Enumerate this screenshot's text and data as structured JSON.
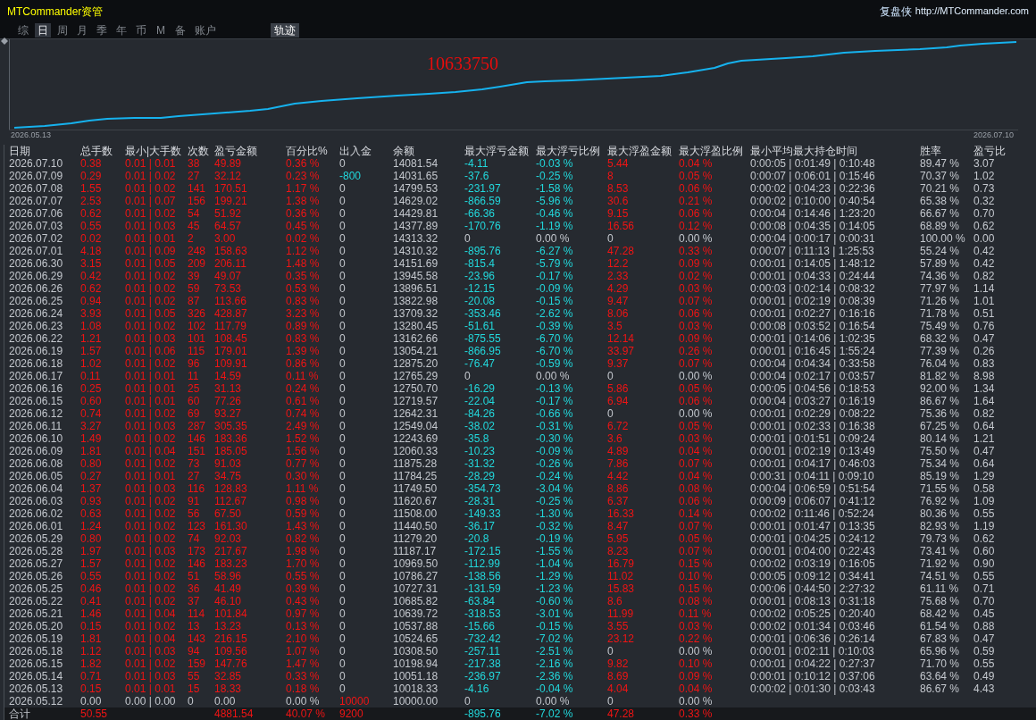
{
  "title_bar": {
    "title": "MTCommander资管",
    "brand": "复盘侠",
    "link": "http://MTCommander.com"
  },
  "tabs": [
    {
      "label": "综",
      "selected": false
    },
    {
      "label": "日",
      "selected": true
    },
    {
      "label": "周",
      "selected": false
    },
    {
      "label": "月",
      "selected": false
    },
    {
      "label": "季",
      "selected": false
    },
    {
      "label": "年",
      "selected": false
    },
    {
      "label": "币",
      "selected": false
    },
    {
      "label": "M",
      "selected": false
    },
    {
      "label": "备",
      "selected": false
    },
    {
      "label": "账户",
      "selected": false
    }
  ],
  "track_toggle": {
    "label": "轨迹",
    "on": true
  },
  "chart": {
    "value": "10633750",
    "x_start": "2026.05.13",
    "x_end": "2026.07.10"
  },
  "table": {
    "columns": [
      "日期",
      "总手数",
      "最小|大手数",
      "次数",
      "盈亏金额",
      "百分比%",
      "出入金",
      "余额",
      "最大浮亏金额",
      "最大浮亏比例",
      "最大浮盈金额",
      "最大浮盈比例",
      "最小平均最大持仓时间",
      "胜率",
      "盈亏比"
    ],
    "rows": [
      [
        "2026.07.10",
        {
          "text": "0.38",
          "color": "#f01414"
        },
        {
          "text": "0.01 | 0.01",
          "color": "#f01414"
        },
        {
          "text": "38",
          "color": "#f01414"
        },
        {
          "text": "49.89",
          "color": "#f01414"
        },
        {
          "text": "0.36 %",
          "color": "#f01414"
        },
        "0",
        "14081.54",
        {
          "text": "-4.11",
          "color": "#22d8dc"
        },
        {
          "text": "-0.03 %",
          "color": "#22d8dc"
        },
        {
          "text": "5.44",
          "color": "#f01414"
        },
        {
          "text": "0.04 %",
          "color": "#f01414"
        },
        "0:00:05 | 0:01:49 | 0:10:48",
        "89.47 %",
        "3.07"
      ],
      [
        "2026.07.09",
        {
          "text": "0.29",
          "color": "#f01414"
        },
        {
          "text": "0.01 | 0.02",
          "color": "#f01414"
        },
        {
          "text": "27",
          "color": "#f01414"
        },
        {
          "text": "32.12",
          "color": "#f01414"
        },
        {
          "text": "0.23 %",
          "color": "#f01414"
        },
        {
          "text": "-800",
          "color": "#22d8dc"
        },
        "14031.65",
        {
          "text": "-37.6",
          "color": "#22d8dc"
        },
        {
          "text": "-0.25 %",
          "color": "#22d8dc"
        },
        {
          "text": "8",
          "color": "#f01414"
        },
        {
          "text": "0.05 %",
          "color": "#f01414"
        },
        "0:00:07 | 0:06:01 | 0:15:46",
        "70.37 %",
        "1.02"
      ],
      [
        "2026.07.08",
        {
          "text": "1.55",
          "color": "#f01414"
        },
        {
          "text": "0.01 | 0.02",
          "color": "#f01414"
        },
        {
          "text": "141",
          "color": "#f01414"
        },
        {
          "text": "170.51",
          "color": "#f01414"
        },
        {
          "text": "1.17 %",
          "color": "#f01414"
        },
        "0",
        "14799.53",
        {
          "text": "-231.97",
          "color": "#22d8dc"
        },
        {
          "text": "-1.58 %",
          "color": "#22d8dc"
        },
        {
          "text": "8.53",
          "color": "#f01414"
        },
        {
          "text": "0.06 %",
          "color": "#f01414"
        },
        "0:00:02 | 0:04:23 | 0:22:36",
        "70.21 %",
        "0.73"
      ],
      [
        "2026.07.07",
        {
          "text": "2.53",
          "color": "#f01414"
        },
        {
          "text": "0.01 | 0.07",
          "color": "#f01414"
        },
        {
          "text": "156",
          "color": "#f01414"
        },
        {
          "text": "199.21",
          "color": "#f01414"
        },
        {
          "text": "1.38 %",
          "color": "#f01414"
        },
        "0",
        "14629.02",
        {
          "text": "-866.59",
          "color": "#22d8dc"
        },
        {
          "text": "-5.96 %",
          "color": "#22d8dc"
        },
        {
          "text": "30.6",
          "color": "#f01414"
        },
        {
          "text": "0.21 %",
          "color": "#f01414"
        },
        "0:00:02 | 0:10:00 | 0:40:54",
        "65.38 %",
        "0.32"
      ],
      [
        "2026.07.06",
        {
          "text": "0.62",
          "color": "#f01414"
        },
        {
          "text": "0.01 | 0.02",
          "color": "#f01414"
        },
        {
          "text": "54",
          "color": "#f01414"
        },
        {
          "text": "51.92",
          "color": "#f01414"
        },
        {
          "text": "0.36 %",
          "color": "#f01414"
        },
        "0",
        "14429.81",
        {
          "text": "-66.36",
          "color": "#22d8dc"
        },
        {
          "text": "-0.46 %",
          "color": "#22d8dc"
        },
        {
          "text": "9.15",
          "color": "#f01414"
        },
        {
          "text": "0.06 %",
          "color": "#f01414"
        },
        "0:00:04 | 0:14:46 | 1:23:20",
        "66.67 %",
        "0.70"
      ],
      [
        "2026.07.03",
        {
          "text": "0.55",
          "color": "#f01414"
        },
        {
          "text": "0.01 | 0.03",
          "color": "#f01414"
        },
        {
          "text": "45",
          "color": "#f01414"
        },
        {
          "text": "64.57",
          "color": "#f01414"
        },
        {
          "text": "0.45 %",
          "color": "#f01414"
        },
        "0",
        "14377.89",
        {
          "text": "-170.76",
          "color": "#22d8dc"
        },
        {
          "text": "-1.19 %",
          "color": "#22d8dc"
        },
        {
          "text": "16.56",
          "color": "#f01414"
        },
        {
          "text": "0.12 %",
          "color": "#f01414"
        },
        "0:00:08 | 0:04:35 | 0:14:05",
        "68.89 %",
        "0.62"
      ],
      [
        "2026.07.02",
        {
          "text": "0.02",
          "color": "#f01414"
        },
        {
          "text": "0.01 | 0.01",
          "color": "#f01414"
        },
        {
          "text": "2",
          "color": "#f01414"
        },
        {
          "text": "3.00",
          "color": "#f01414"
        },
        {
          "text": "0.02 %",
          "color": "#f01414"
        },
        "0",
        "14313.32",
        "0",
        "0.00 %",
        "0",
        "0.00 %",
        "0:00:04 | 0:00:17 | 0:00:31",
        "100.00 %",
        "0.00"
      ],
      [
        "2026.07.01",
        {
          "text": "4.18",
          "color": "#f01414"
        },
        {
          "text": "0.01 | 0.09",
          "color": "#f01414"
        },
        {
          "text": "248",
          "color": "#f01414"
        },
        {
          "text": "158.63",
          "color": "#f01414"
        },
        {
          "text": "1.12 %",
          "color": "#f01414"
        },
        "0",
        "14310.32",
        {
          "text": "-895.76",
          "color": "#22d8dc"
        },
        {
          "text": "-6.27 %",
          "color": "#22d8dc"
        },
        {
          "text": "47.28",
          "color": "#f01414"
        },
        {
          "text": "0.33 %",
          "color": "#f01414"
        },
        "0:00:07 | 0:11:13 | 1:25:53",
        "55.24 %",
        "0.42"
      ],
      [
        "2026.06.30",
        {
          "text": "3.15",
          "color": "#f01414"
        },
        {
          "text": "0.01 | 0.05",
          "color": "#f01414"
        },
        {
          "text": "209",
          "color": "#f01414"
        },
        {
          "text": "206.11",
          "color": "#f01414"
        },
        {
          "text": "1.48 %",
          "color": "#f01414"
        },
        "0",
        "14151.69",
        {
          "text": "-815.4",
          "color": "#22d8dc"
        },
        {
          "text": "-5.79 %",
          "color": "#22d8dc"
        },
        {
          "text": "12.2",
          "color": "#f01414"
        },
        {
          "text": "0.09 %",
          "color": "#f01414"
        },
        "0:00:01 | 0:14:05 | 1:48:12",
        "57.89 %",
        "0.42"
      ],
      [
        "2026.06.29",
        {
          "text": "0.42",
          "color": "#f01414"
        },
        {
          "text": "0.01 | 0.02",
          "color": "#f01414"
        },
        {
          "text": "39",
          "color": "#f01414"
        },
        {
          "text": "49.07",
          "color": "#f01414"
        },
        {
          "text": "0.35 %",
          "color": "#f01414"
        },
        "0",
        "13945.58",
        {
          "text": "-23.96",
          "color": "#22d8dc"
        },
        {
          "text": "-0.17 %",
          "color": "#22d8dc"
        },
        {
          "text": "2.33",
          "color": "#f01414"
        },
        {
          "text": "0.02 %",
          "color": "#f01414"
        },
        "0:00:01 | 0:04:33 | 0:24:44",
        "74.36 %",
        "0.82"
      ],
      [
        "2026.06.26",
        {
          "text": "0.62",
          "color": "#f01414"
        },
        {
          "text": "0.01 | 0.02",
          "color": "#f01414"
        },
        {
          "text": "59",
          "color": "#f01414"
        },
        {
          "text": "73.53",
          "color": "#f01414"
        },
        {
          "text": "0.53 %",
          "color": "#f01414"
        },
        "0",
        "13896.51",
        {
          "text": "-12.15",
          "color": "#22d8dc"
        },
        {
          "text": "-0.09 %",
          "color": "#22d8dc"
        },
        {
          "text": "4.29",
          "color": "#f01414"
        },
        {
          "text": "0.03 %",
          "color": "#f01414"
        },
        "0:00:03 | 0:02:14 | 0:08:32",
        "77.97 %",
        "1.14"
      ],
      [
        "2026.06.25",
        {
          "text": "0.94",
          "color": "#f01414"
        },
        {
          "text": "0.01 | 0.02",
          "color": "#f01414"
        },
        {
          "text": "87",
          "color": "#f01414"
        },
        {
          "text": "113.66",
          "color": "#f01414"
        },
        {
          "text": "0.83 %",
          "color": "#f01414"
        },
        "0",
        "13822.98",
        {
          "text": "-20.08",
          "color": "#22d8dc"
        },
        {
          "text": "-0.15 %",
          "color": "#22d8dc"
        },
        {
          "text": "9.47",
          "color": "#f01414"
        },
        {
          "text": "0.07 %",
          "color": "#f01414"
        },
        "0:00:01 | 0:02:19 | 0:08:39",
        "71.26 %",
        "1.01"
      ],
      [
        "2026.06.24",
        {
          "text": "3.93",
          "color": "#f01414"
        },
        {
          "text": "0.01 | 0.05",
          "color": "#f01414"
        },
        {
          "text": "326",
          "color": "#f01414"
        },
        {
          "text": "428.87",
          "color": "#f01414"
        },
        {
          "text": "3.23 %",
          "color": "#f01414"
        },
        "0",
        "13709.32",
        {
          "text": "-353.46",
          "color": "#22d8dc"
        },
        {
          "text": "-2.62 %",
          "color": "#22d8dc"
        },
        {
          "text": "8.06",
          "color": "#f01414"
        },
        {
          "text": "0.06 %",
          "color": "#f01414"
        },
        "0:00:01 | 0:02:27 | 0:16:16",
        "71.78 %",
        "0.51"
      ],
      [
        "2026.06.23",
        {
          "text": "1.08",
          "color": "#f01414"
        },
        {
          "text": "0.01 | 0.02",
          "color": "#f01414"
        },
        {
          "text": "102",
          "color": "#f01414"
        },
        {
          "text": "117.79",
          "color": "#f01414"
        },
        {
          "text": "0.89 %",
          "color": "#f01414"
        },
        "0",
        "13280.45",
        {
          "text": "-51.61",
          "color": "#22d8dc"
        },
        {
          "text": "-0.39 %",
          "color": "#22d8dc"
        },
        {
          "text": "3.5",
          "color": "#f01414"
        },
        {
          "text": "0.03 %",
          "color": "#f01414"
        },
        "0:00:08 | 0:03:52 | 0:16:54",
        "75.49 %",
        "0.76"
      ],
      [
        "2026.06.22",
        {
          "text": "1.21",
          "color": "#f01414"
        },
        {
          "text": "0.01 | 0.03",
          "color": "#f01414"
        },
        {
          "text": "101",
          "color": "#f01414"
        },
        {
          "text": "108.45",
          "color": "#f01414"
        },
        {
          "text": "0.83 %",
          "color": "#f01414"
        },
        "0",
        "13162.66",
        {
          "text": "-875.55",
          "color": "#22d8dc"
        },
        {
          "text": "-6.70 %",
          "color": "#22d8dc"
        },
        {
          "text": "12.14",
          "color": "#f01414"
        },
        {
          "text": "0.09 %",
          "color": "#f01414"
        },
        "0:00:01 | 0:14:06 | 1:02:35",
        "68.32 %",
        "0.47"
      ],
      [
        "2026.06.19",
        {
          "text": "1.57",
          "color": "#f01414"
        },
        {
          "text": "0.01 | 0.06",
          "color": "#f01414"
        },
        {
          "text": "115",
          "color": "#f01414"
        },
        {
          "text": "179.01",
          "color": "#f01414"
        },
        {
          "text": "1.39 %",
          "color": "#f01414"
        },
        "0",
        "13054.21",
        {
          "text": "-866.95",
          "color": "#22d8dc"
        },
        {
          "text": "-6.70 %",
          "color": "#22d8dc"
        },
        {
          "text": "33.97",
          "color": "#f01414"
        },
        {
          "text": "0.26 %",
          "color": "#f01414"
        },
        "0:00:01 | 0:16:45 | 1:55:24",
        "77.39 %",
        "0.26"
      ],
      [
        "2026.06.18",
        {
          "text": "1.02",
          "color": "#f01414"
        },
        {
          "text": "0.01 | 0.02",
          "color": "#f01414"
        },
        {
          "text": "96",
          "color": "#f01414"
        },
        {
          "text": "109.91",
          "color": "#f01414"
        },
        {
          "text": "0.86 %",
          "color": "#f01414"
        },
        "0",
        "12875.20",
        {
          "text": "-76.47",
          "color": "#22d8dc"
        },
        {
          "text": "-0.59 %",
          "color": "#22d8dc"
        },
        {
          "text": "9.37",
          "color": "#f01414"
        },
        {
          "text": "0.07 %",
          "color": "#f01414"
        },
        "0:00:04 | 0:04:34 | 0:33:58",
        "76.04 %",
        "0.83"
      ],
      [
        "2026.06.17",
        {
          "text": "0.11",
          "color": "#f01414"
        },
        {
          "text": "0.01 | 0.01",
          "color": "#f01414"
        },
        {
          "text": "11",
          "color": "#f01414"
        },
        {
          "text": "14.59",
          "color": "#f01414"
        },
        {
          "text": "0.11 %",
          "color": "#f01414"
        },
        "0",
        "12765.29",
        "0",
        "0.00 %",
        "0",
        "0.00 %",
        "0:00:04 | 0:02:17 | 0:03:57",
        "81.82 %",
        "8.98"
      ],
      [
        "2026.06.16",
        {
          "text": "0.25",
          "color": "#f01414"
        },
        {
          "text": "0.01 | 0.01",
          "color": "#f01414"
        },
        {
          "text": "25",
          "color": "#f01414"
        },
        {
          "text": "31.13",
          "color": "#f01414"
        },
        {
          "text": "0.24 %",
          "color": "#f01414"
        },
        "0",
        "12750.70",
        {
          "text": "-16.29",
          "color": "#22d8dc"
        },
        {
          "text": "-0.13 %",
          "color": "#22d8dc"
        },
        {
          "text": "5.86",
          "color": "#f01414"
        },
        {
          "text": "0.05 %",
          "color": "#f01414"
        },
        "0:00:05 | 0:04:56 | 0:18:53",
        "92.00 %",
        "1.34"
      ],
      [
        "2026.06.15",
        {
          "text": "0.60",
          "color": "#f01414"
        },
        {
          "text": "0.01 | 0.01",
          "color": "#f01414"
        },
        {
          "text": "60",
          "color": "#f01414"
        },
        {
          "text": "77.26",
          "color": "#f01414"
        },
        {
          "text": "0.61 %",
          "color": "#f01414"
        },
        "0",
        "12719.57",
        {
          "text": "-22.04",
          "color": "#22d8dc"
        },
        {
          "text": "-0.17 %",
          "color": "#22d8dc"
        },
        {
          "text": "6.94",
          "color": "#f01414"
        },
        {
          "text": "0.06 %",
          "color": "#f01414"
        },
        "0:00:04 | 0:03:27 | 0:16:19",
        "86.67 %",
        "1.64"
      ],
      [
        "2026.06.12",
        {
          "text": "0.74",
          "color": "#f01414"
        },
        {
          "text": "0.01 | 0.02",
          "color": "#f01414"
        },
        {
          "text": "69",
          "color": "#f01414"
        },
        {
          "text": "93.27",
          "color": "#f01414"
        },
        {
          "text": "0.74 %",
          "color": "#f01414"
        },
        "0",
        "12642.31",
        {
          "text": "-84.26",
          "color": "#22d8dc"
        },
        {
          "text": "-0.66 %",
          "color": "#22d8dc"
        },
        "0",
        "0.00 %",
        "0:00:01 | 0:02:29 | 0:08:22",
        "75.36 %",
        "0.82"
      ],
      [
        "2026.06.11",
        {
          "text": "3.27",
          "color": "#f01414"
        },
        {
          "text": "0.01 | 0.03",
          "color": "#f01414"
        },
        {
          "text": "287",
          "color": "#f01414"
        },
        {
          "text": "305.35",
          "color": "#f01414"
        },
        {
          "text": "2.49 %",
          "color": "#f01414"
        },
        "0",
        "12549.04",
        {
          "text": "-38.02",
          "color": "#22d8dc"
        },
        {
          "text": "-0.31 %",
          "color": "#22d8dc"
        },
        {
          "text": "6.72",
          "color": "#f01414"
        },
        {
          "text": "0.05 %",
          "color": "#f01414"
        },
        "0:00:01 | 0:02:33 | 0:16:38",
        "67.25 %",
        "0.64"
      ],
      [
        "2026.06.10",
        {
          "text": "1.49",
          "color": "#f01414"
        },
        {
          "text": "0.01 | 0.02",
          "color": "#f01414"
        },
        {
          "text": "146",
          "color": "#f01414"
        },
        {
          "text": "183.36",
          "color": "#f01414"
        },
        {
          "text": "1.52 %",
          "color": "#f01414"
        },
        "0",
        "12243.69",
        {
          "text": "-35.8",
          "color": "#22d8dc"
        },
        {
          "text": "-0.30 %",
          "color": "#22d8dc"
        },
        {
          "text": "3.6",
          "color": "#f01414"
        },
        {
          "text": "0.03 %",
          "color": "#f01414"
        },
        "0:00:01 | 0:01:51 | 0:09:24",
        "80.14 %",
        "1.21"
      ],
      [
        "2026.06.09",
        {
          "text": "1.81",
          "color": "#f01414"
        },
        {
          "text": "0.01 | 0.04",
          "color": "#f01414"
        },
        {
          "text": "151",
          "color": "#f01414"
        },
        {
          "text": "185.05",
          "color": "#f01414"
        },
        {
          "text": "1.56 %",
          "color": "#f01414"
        },
        "0",
        "12060.33",
        {
          "text": "-10.23",
          "color": "#22d8dc"
        },
        {
          "text": "-0.09 %",
          "color": "#22d8dc"
        },
        {
          "text": "4.89",
          "color": "#f01414"
        },
        {
          "text": "0.04 %",
          "color": "#f01414"
        },
        "0:00:01 | 0:02:19 | 0:13:49",
        "75.50 %",
        "0.47"
      ],
      [
        "2026.06.08",
        {
          "text": "0.80",
          "color": "#f01414"
        },
        {
          "text": "0.01 | 0.02",
          "color": "#f01414"
        },
        {
          "text": "73",
          "color": "#f01414"
        },
        {
          "text": "91.03",
          "color": "#f01414"
        },
        {
          "text": "0.77 %",
          "color": "#f01414"
        },
        "0",
        "11875.28",
        {
          "text": "-31.32",
          "color": "#22d8dc"
        },
        {
          "text": "-0.26 %",
          "color": "#22d8dc"
        },
        {
          "text": "7.86",
          "color": "#f01414"
        },
        {
          "text": "0.07 %",
          "color": "#f01414"
        },
        "0:00:01 | 0:04:17 | 0:46:03",
        "75.34 %",
        "0.64"
      ],
      [
        "2026.06.05",
        {
          "text": "0.27",
          "color": "#f01414"
        },
        {
          "text": "0.01 | 0.01",
          "color": "#f01414"
        },
        {
          "text": "27",
          "color": "#f01414"
        },
        {
          "text": "34.75",
          "color": "#f01414"
        },
        {
          "text": "0.30 %",
          "color": "#f01414"
        },
        "0",
        "11784.25",
        {
          "text": "-28.29",
          "color": "#22d8dc"
        },
        {
          "text": "-0.24 %",
          "color": "#22d8dc"
        },
        {
          "text": "4.42",
          "color": "#f01414"
        },
        {
          "text": "0.04 %",
          "color": "#f01414"
        },
        "0:00:31 | 0:04:11 | 0:09:10",
        "85.19 %",
        "1.29"
      ],
      [
        "2026.06.04",
        {
          "text": "1.37",
          "color": "#f01414"
        },
        {
          "text": "0.01 | 0.03",
          "color": "#f01414"
        },
        {
          "text": "116",
          "color": "#f01414"
        },
        {
          "text": "128.83",
          "color": "#f01414"
        },
        {
          "text": "1.11 %",
          "color": "#f01414"
        },
        "0",
        "11749.50",
        {
          "text": "-354.73",
          "color": "#22d8dc"
        },
        {
          "text": "-3.04 %",
          "color": "#22d8dc"
        },
        {
          "text": "8.86",
          "color": "#f01414"
        },
        {
          "text": "0.08 %",
          "color": "#f01414"
        },
        "0:00:04 | 0:06:59 | 0:51:54",
        "71.55 %",
        "0.58"
      ],
      [
        "2026.06.03",
        {
          "text": "0.93",
          "color": "#f01414"
        },
        {
          "text": "0.01 | 0.02",
          "color": "#f01414"
        },
        {
          "text": "91",
          "color": "#f01414"
        },
        {
          "text": "112.67",
          "color": "#f01414"
        },
        {
          "text": "0.98 %",
          "color": "#f01414"
        },
        "0",
        "11620.67",
        {
          "text": "-28.31",
          "color": "#22d8dc"
        },
        {
          "text": "-0.25 %",
          "color": "#22d8dc"
        },
        {
          "text": "6.37",
          "color": "#f01414"
        },
        {
          "text": "0.06 %",
          "color": "#f01414"
        },
        "0:00:09 | 0:06:07 | 0:41:12",
        "76.92 %",
        "1.09"
      ],
      [
        "2026.06.02",
        {
          "text": "0.63",
          "color": "#f01414"
        },
        {
          "text": "0.01 | 0.02",
          "color": "#f01414"
        },
        {
          "text": "56",
          "color": "#f01414"
        },
        {
          "text": "67.50",
          "color": "#f01414"
        },
        {
          "text": "0.59 %",
          "color": "#f01414"
        },
        "0",
        "11508.00",
        {
          "text": "-149.33",
          "color": "#22d8dc"
        },
        {
          "text": "-1.30 %",
          "color": "#22d8dc"
        },
        {
          "text": "16.33",
          "color": "#f01414"
        },
        {
          "text": "0.14 %",
          "color": "#f01414"
        },
        "0:00:02 | 0:11:46 | 0:52:24",
        "80.36 %",
        "0.55"
      ],
      [
        "2026.06.01",
        {
          "text": "1.24",
          "color": "#f01414"
        },
        {
          "text": "0.01 | 0.02",
          "color": "#f01414"
        },
        {
          "text": "123",
          "color": "#f01414"
        },
        {
          "text": "161.30",
          "color": "#f01414"
        },
        {
          "text": "1.43 %",
          "color": "#f01414"
        },
        "0",
        "11440.50",
        {
          "text": "-36.17",
          "color": "#22d8dc"
        },
        {
          "text": "-0.32 %",
          "color": "#22d8dc"
        },
        {
          "text": "8.47",
          "color": "#f01414"
        },
        {
          "text": "0.07 %",
          "color": "#f01414"
        },
        "0:00:01 | 0:01:47 | 0:13:35",
        "82.93 %",
        "1.19"
      ],
      [
        "2026.05.29",
        {
          "text": "0.80",
          "color": "#f01414"
        },
        {
          "text": "0.01 | 0.02",
          "color": "#f01414"
        },
        {
          "text": "74",
          "color": "#f01414"
        },
        {
          "text": "92.03",
          "color": "#f01414"
        },
        {
          "text": "0.82 %",
          "color": "#f01414"
        },
        "0",
        "11279.20",
        {
          "text": "-20.8",
          "color": "#22d8dc"
        },
        {
          "text": "-0.19 %",
          "color": "#22d8dc"
        },
        {
          "text": "5.95",
          "color": "#f01414"
        },
        {
          "text": "0.05 %",
          "color": "#f01414"
        },
        "0:00:01 | 0:04:25 | 0:24:12",
        "79.73 %",
        "0.62"
      ],
      [
        "2026.05.28",
        {
          "text": "1.97",
          "color": "#f01414"
        },
        {
          "text": "0.01 | 0.03",
          "color": "#f01414"
        },
        {
          "text": "173",
          "color": "#f01414"
        },
        {
          "text": "217.67",
          "color": "#f01414"
        },
        {
          "text": "1.98 %",
          "color": "#f01414"
        },
        "0",
        "11187.17",
        {
          "text": "-172.15",
          "color": "#22d8dc"
        },
        {
          "text": "-1.55 %",
          "color": "#22d8dc"
        },
        {
          "text": "8.23",
          "color": "#f01414"
        },
        {
          "text": "0.07 %",
          "color": "#f01414"
        },
        "0:00:01 | 0:04:00 | 0:22:43",
        "73.41 %",
        "0.60"
      ],
      [
        "2026.05.27",
        {
          "text": "1.57",
          "color": "#f01414"
        },
        {
          "text": "0.01 | 0.02",
          "color": "#f01414"
        },
        {
          "text": "146",
          "color": "#f01414"
        },
        {
          "text": "183.23",
          "color": "#f01414"
        },
        {
          "text": "1.70 %",
          "color": "#f01414"
        },
        "0",
        "10969.50",
        {
          "text": "-112.99",
          "color": "#22d8dc"
        },
        {
          "text": "-1.04 %",
          "color": "#22d8dc"
        },
        {
          "text": "16.79",
          "color": "#f01414"
        },
        {
          "text": "0.15 %",
          "color": "#f01414"
        },
        "0:00:02 | 0:03:19 | 0:16:05",
        "71.92 %",
        "0.90"
      ],
      [
        "2026.05.26",
        {
          "text": "0.55",
          "color": "#f01414"
        },
        {
          "text": "0.01 | 0.02",
          "color": "#f01414"
        },
        {
          "text": "51",
          "color": "#f01414"
        },
        {
          "text": "58.96",
          "color": "#f01414"
        },
        {
          "text": "0.55 %",
          "color": "#f01414"
        },
        "0",
        "10786.27",
        {
          "text": "-138.56",
          "color": "#22d8dc"
        },
        {
          "text": "-1.29 %",
          "color": "#22d8dc"
        },
        {
          "text": "11.02",
          "color": "#f01414"
        },
        {
          "text": "0.10 %",
          "color": "#f01414"
        },
        "0:00:05 | 0:09:12 | 0:34:41",
        "74.51 %",
        "0.55"
      ],
      [
        "2026.05.25",
        {
          "text": "0.46",
          "color": "#f01414"
        },
        {
          "text": "0.01 | 0.02",
          "color": "#f01414"
        },
        {
          "text": "36",
          "color": "#f01414"
        },
        {
          "text": "41.49",
          "color": "#f01414"
        },
        {
          "text": "0.39 %",
          "color": "#f01414"
        },
        "0",
        "10727.31",
        {
          "text": "-131.59",
          "color": "#22d8dc"
        },
        {
          "text": "-1.23 %",
          "color": "#22d8dc"
        },
        {
          "text": "15.83",
          "color": "#f01414"
        },
        {
          "text": "0.15 %",
          "color": "#f01414"
        },
        "0:00:06 | 0:44:50 | 2:27:32",
        "61.11 %",
        "0.71"
      ],
      [
        "2026.05.22",
        {
          "text": "0.41",
          "color": "#f01414"
        },
        {
          "text": "0.01 | 0.02",
          "color": "#f01414"
        },
        {
          "text": "37",
          "color": "#f01414"
        },
        {
          "text": "46.10",
          "color": "#f01414"
        },
        {
          "text": "0.43 %",
          "color": "#f01414"
        },
        "0",
        "10685.82",
        {
          "text": "-63.84",
          "color": "#22d8dc"
        },
        {
          "text": "-0.60 %",
          "color": "#22d8dc"
        },
        {
          "text": "8.6",
          "color": "#f01414"
        },
        {
          "text": "0.08 %",
          "color": "#f01414"
        },
        "0:00:01 | 0:08:13 | 0:31:18",
        "75.68 %",
        "0.70"
      ],
      [
        "2026.05.21",
        {
          "text": "1.46",
          "color": "#f01414"
        },
        {
          "text": "0.01 | 0.04",
          "color": "#f01414"
        },
        {
          "text": "114",
          "color": "#f01414"
        },
        {
          "text": "101.84",
          "color": "#f01414"
        },
        {
          "text": "0.97 %",
          "color": "#f01414"
        },
        "0",
        "10639.72",
        {
          "text": "-318.53",
          "color": "#22d8dc"
        },
        {
          "text": "-3.01 %",
          "color": "#22d8dc"
        },
        {
          "text": "11.99",
          "color": "#f01414"
        },
        {
          "text": "0.11 %",
          "color": "#f01414"
        },
        "0:00:02 | 0:05:25 | 0:20:40",
        "68.42 %",
        "0.45"
      ],
      [
        "2026.05.20",
        {
          "text": "0.15",
          "color": "#f01414"
        },
        {
          "text": "0.01 | 0.02",
          "color": "#f01414"
        },
        {
          "text": "13",
          "color": "#f01414"
        },
        {
          "text": "13.23",
          "color": "#f01414"
        },
        {
          "text": "0.13 %",
          "color": "#f01414"
        },
        "0",
        "10537.88",
        {
          "text": "-15.66",
          "color": "#22d8dc"
        },
        {
          "text": "-0.15 %",
          "color": "#22d8dc"
        },
        {
          "text": "3.55",
          "color": "#f01414"
        },
        {
          "text": "0.03 %",
          "color": "#f01414"
        },
        "0:00:02 | 0:01:34 | 0:03:46",
        "61.54 %",
        "0.88"
      ],
      [
        "2026.05.19",
        {
          "text": "1.81",
          "color": "#f01414"
        },
        {
          "text": "0.01 | 0.04",
          "color": "#f01414"
        },
        {
          "text": "143",
          "color": "#f01414"
        },
        {
          "text": "216.15",
          "color": "#f01414"
        },
        {
          "text": "2.10 %",
          "color": "#f01414"
        },
        "0",
        "10524.65",
        {
          "text": "-732.42",
          "color": "#22d8dc"
        },
        {
          "text": "-7.02 %",
          "color": "#22d8dc"
        },
        {
          "text": "23.12",
          "color": "#f01414"
        },
        {
          "text": "0.22 %",
          "color": "#f01414"
        },
        "0:00:01 | 0:06:36 | 0:26:14",
        "67.83 %",
        "0.47"
      ],
      [
        "2026.05.18",
        {
          "text": "1.12",
          "color": "#f01414"
        },
        {
          "text": "0.01 | 0.03",
          "color": "#f01414"
        },
        {
          "text": "94",
          "color": "#f01414"
        },
        {
          "text": "109.56",
          "color": "#f01414"
        },
        {
          "text": "1.07 %",
          "color": "#f01414"
        },
        "0",
        "10308.50",
        {
          "text": "-257.11",
          "color": "#22d8dc"
        },
        {
          "text": "-2.51 %",
          "color": "#22d8dc"
        },
        "0",
        "0.00 %",
        "0:00:01 | 0:02:11 | 0:10:03",
        "65.96 %",
        "0.59"
      ],
      [
        "2026.05.15",
        {
          "text": "1.82",
          "color": "#f01414"
        },
        {
          "text": "0.01 | 0.02",
          "color": "#f01414"
        },
        {
          "text": "159",
          "color": "#f01414"
        },
        {
          "text": "147.76",
          "color": "#f01414"
        },
        {
          "text": "1.47 %",
          "color": "#f01414"
        },
        "0",
        "10198.94",
        {
          "text": "-217.38",
          "color": "#22d8dc"
        },
        {
          "text": "-2.16 %",
          "color": "#22d8dc"
        },
        {
          "text": "9.82",
          "color": "#f01414"
        },
        {
          "text": "0.10 %",
          "color": "#f01414"
        },
        "0:00:01 | 0:04:22 | 0:27:37",
        "71.70 %",
        "0.55"
      ],
      [
        "2026.05.14",
        {
          "text": "0.71",
          "color": "#f01414"
        },
        {
          "text": "0.01 | 0.03",
          "color": "#f01414"
        },
        {
          "text": "55",
          "color": "#f01414"
        },
        {
          "text": "32.85",
          "color": "#f01414"
        },
        {
          "text": "0.33 %",
          "color": "#f01414"
        },
        "0",
        "10051.18",
        {
          "text": "-236.97",
          "color": "#22d8dc"
        },
        {
          "text": "-2.36 %",
          "color": "#22d8dc"
        },
        {
          "text": "8.69",
          "color": "#f01414"
        },
        {
          "text": "0.09 %",
          "color": "#f01414"
        },
        "0:00:01 | 0:10:12 | 0:37:06",
        "63.64 %",
        "0.49"
      ],
      [
        "2026.05.13",
        {
          "text": "0.15",
          "color": "#f01414"
        },
        {
          "text": "0.01 | 0.01",
          "color": "#f01414"
        },
        {
          "text": "15",
          "color": "#f01414"
        },
        {
          "text": "18.33",
          "color": "#f01414"
        },
        {
          "text": "0.18 %",
          "color": "#f01414"
        },
        "0",
        "10018.33",
        {
          "text": "-4.16",
          "color": "#22d8dc"
        },
        {
          "text": "-0.04 %",
          "color": "#22d8dc"
        },
        {
          "text": "4.04",
          "color": "#f01414"
        },
        {
          "text": "0.04 %",
          "color": "#f01414"
        },
        "0:00:02 | 0:01:30 | 0:03:43",
        "86.67 %",
        "4.43"
      ],
      [
        "2026.05.12",
        "0.00",
        "0.00 | 0.00",
        "0",
        "0.00",
        "0.00 %",
        {
          "text": "10000",
          "color": "#f01414"
        },
        "10000.00",
        "0",
        "0.00 %",
        "0",
        "0.00 %"
      ]
    ],
    "total": {
      "label": "合计",
      "lots": {
        "text": "50.55",
        "color": "#f01414"
      },
      "pnl": {
        "text": "4881.54",
        "color": "#f01414"
      },
      "percent": {
        "text": "40.07 %",
        "color": "#f01414"
      },
      "deposit": {
        "text": "9200",
        "color": "#f01414"
      },
      "max_float_loss": {
        "text": "-895.76",
        "color": "#22d8dc"
      },
      "max_float_loss_pct": {
        "text": "-7.02 %",
        "color": "#22d8dc"
      },
      "max_float_profit": {
        "text": "47.28",
        "color": "#f01414"
      },
      "max_float_profit_pct": {
        "text": "0.33 %",
        "color": "#f01414"
      }
    }
  }
}
